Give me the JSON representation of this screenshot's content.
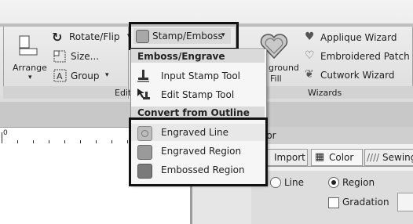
{
  "ribbon": {
    "rotate_flip": "Rotate/Flip",
    "size": "Size...",
    "group": "Group",
    "arrange": "Arrange",
    "stamp_emboss": "Stamp/Emboss",
    "background_fill_a": "ground",
    "background_fill_b": "Fill",
    "applique_wizard": "Applique Wizard",
    "embroidered_patch": "Embroidered Patch",
    "cutwork_wizard": "Cutwork Wizard",
    "edit_group": "Edit",
    "wizards_group": "Wizards"
  },
  "menu": {
    "section_emboss": "Emboss/Engrave",
    "input_stamp_tool": "Input Stamp Tool",
    "edit_stamp_tool": "Edit Stamp Tool",
    "section_convert": "Convert from Outline",
    "engraved_line": "Engraved Line",
    "engraved_region": "Engraved Region",
    "embossed_region": "Embossed Region"
  },
  "ruler": {
    "zero": "0"
  },
  "panel": {
    "title_partial": "lor",
    "tab_import": "Import",
    "tab_color": "Color",
    "tab_sewing": "Sewing",
    "radio_line": "Line",
    "radio_region": "Region",
    "checkbox_gradation": "Gradation"
  }
}
